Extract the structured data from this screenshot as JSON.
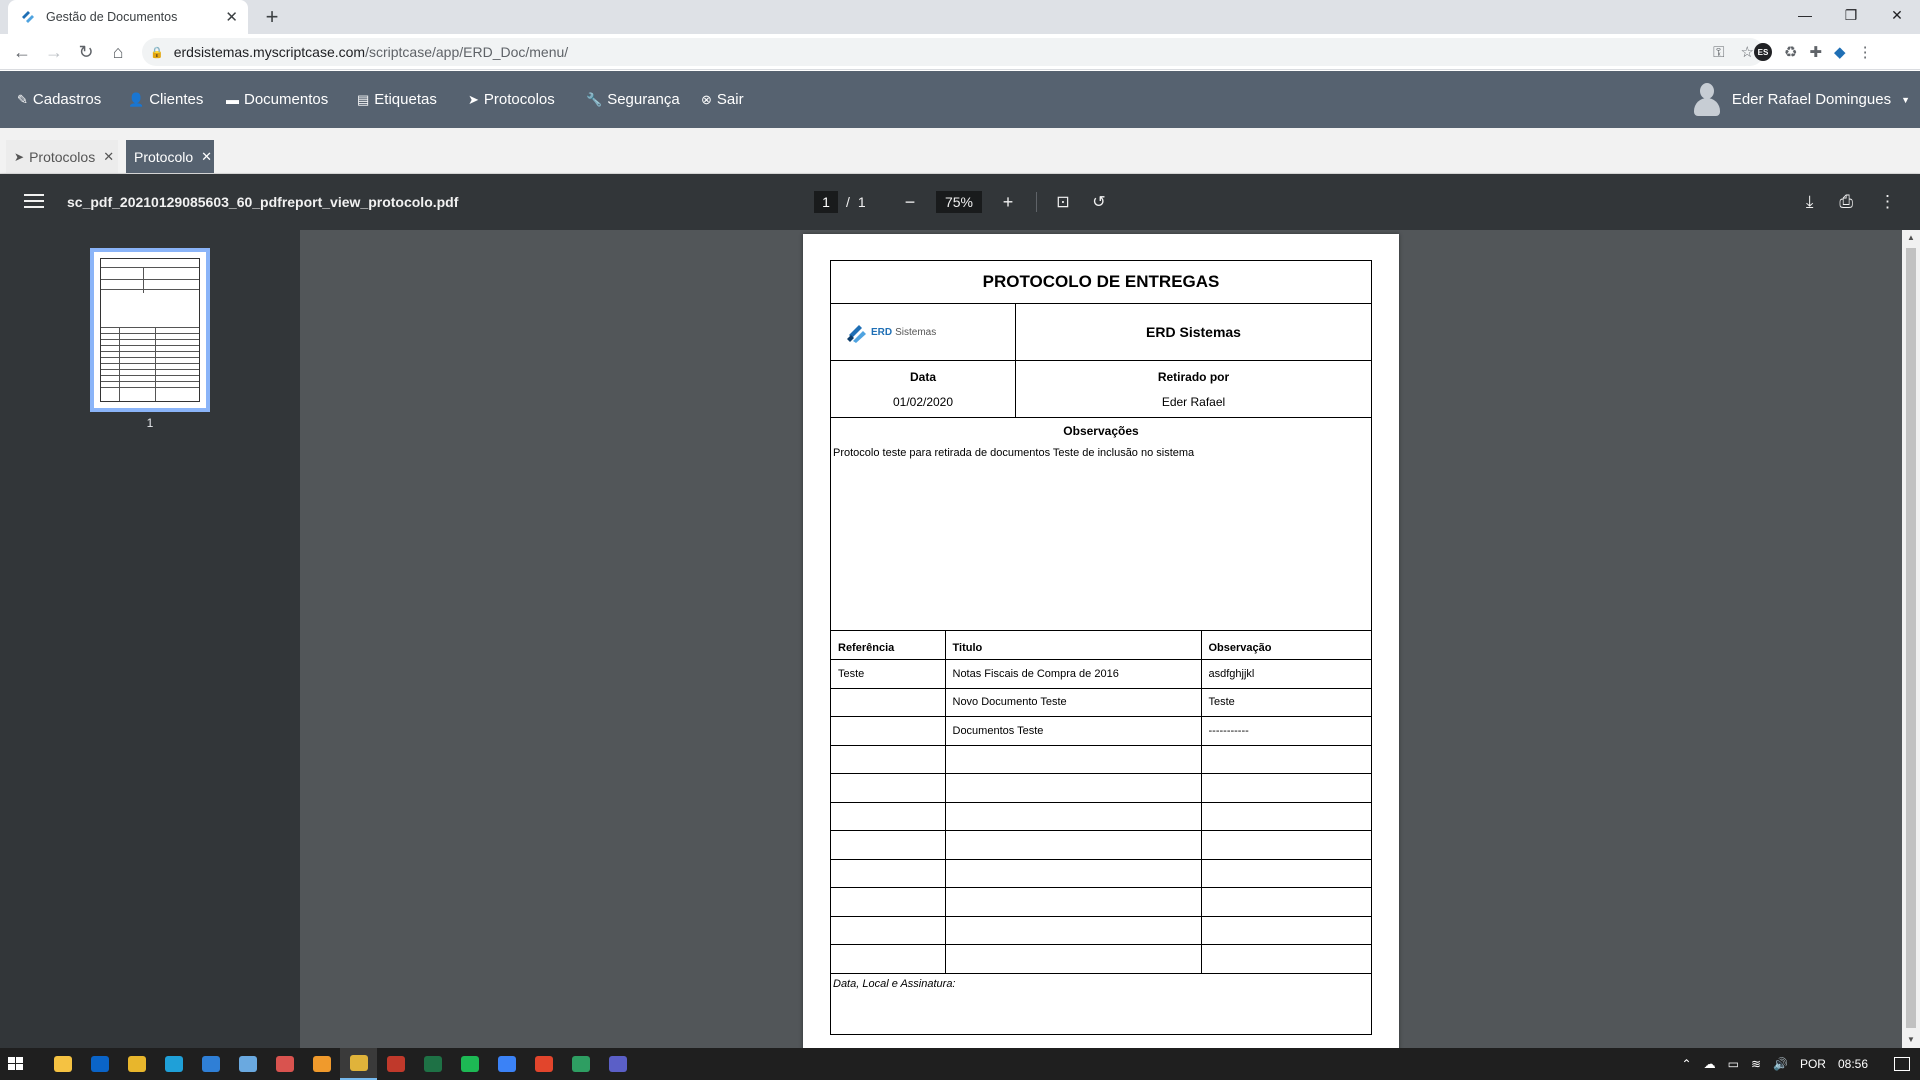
{
  "browser": {
    "tab_title": "Gestão de Documentos",
    "url_host": "erdsistemas.myscriptcase.com",
    "url_path": "/scriptcase/app/ERD_Doc/menu/",
    "ext_es": "ES"
  },
  "menu": {
    "items": [
      {
        "label": "Cadastros",
        "icon": "edit-icon"
      },
      {
        "label": "Clientes",
        "icon": "user-icon"
      },
      {
        "label": "Documentos",
        "icon": "document-icon"
      },
      {
        "label": "Etiquetas",
        "icon": "book-icon"
      },
      {
        "label": "Protocolos",
        "icon": "paper-plane-icon"
      },
      {
        "label": "Segurança",
        "icon": "wrench-icon"
      },
      {
        "label": "Sair",
        "icon": "close-circle-icon"
      }
    ],
    "user_name": "Eder Rafael Domingues"
  },
  "app_tabs": [
    {
      "label": "Protocolos",
      "active": false
    },
    {
      "label": "Protocolo",
      "active": true
    }
  ],
  "pdf_viewer": {
    "filename": "sc_pdf_20210129085603_60_pdfreport_view_protocolo.pdf",
    "current_page": "1",
    "page_sep": "/",
    "total_pages": "1",
    "zoom": "75%",
    "thumbnail_label": "1"
  },
  "document": {
    "title": "PROTOCOLO DE ENTREGAS",
    "logo_text_bold": "ERD",
    "logo_text": "Sistemas",
    "company": "ERD Sistemas",
    "date_label": "Data",
    "date_value": "01/02/2020",
    "withdrawn_label": "Retirado por",
    "withdrawn_value": "Eder Rafael",
    "obs_label": "Observações",
    "obs_text": "Protocolo teste para retirada de documentos  Teste de inclusão no sistema",
    "columns": [
      "Referência",
      "Titulo",
      "Observação"
    ],
    "rows": [
      [
        "Teste",
        "Notas Fiscais de Compra de 2016",
        "asdfghjjkl"
      ],
      [
        "",
        "Novo Documento Teste",
        "Teste"
      ],
      [
        "",
        "Documentos Teste",
        "-----------"
      ],
      [
        "",
        "",
        ""
      ],
      [
        "",
        "",
        ""
      ],
      [
        "",
        "",
        ""
      ],
      [
        "",
        "",
        ""
      ],
      [
        "",
        "",
        ""
      ],
      [
        "",
        "",
        ""
      ],
      [
        "",
        "",
        ""
      ],
      [
        "",
        "",
        ""
      ]
    ],
    "signature_label": "Data, Local e Assinatura:"
  },
  "taskbar": {
    "apps": [
      {
        "name": "file-explorer-icon",
        "color": "#f5c242"
      },
      {
        "name": "outlook-icon",
        "color": "#0a64c8"
      },
      {
        "name": "folder-app-icon",
        "color": "#e8b62c"
      },
      {
        "name": "edge-icon",
        "color": "#1fa0d8"
      },
      {
        "name": "mail-icon",
        "color": "#2f7fd6"
      },
      {
        "name": "notes-icon",
        "color": "#6aa9e0"
      },
      {
        "name": "app-red-icon",
        "color": "#d9534f"
      },
      {
        "name": "sublime-icon",
        "color": "#f09a2c"
      },
      {
        "name": "chrome-icon",
        "color": "#e0b33a",
        "active": true
      },
      {
        "name": "app-jet-icon",
        "color": "#c0392b"
      },
      {
        "name": "excel-icon",
        "color": "#1e7145"
      },
      {
        "name": "spotify-icon",
        "color": "#1db954"
      },
      {
        "name": "app-blue-icon",
        "color": "#3b82f6"
      },
      {
        "name": "brave-icon",
        "color": "#e2452c"
      },
      {
        "name": "app-window-icon",
        "color": "#2e9e62"
      },
      {
        "name": "teams-icon",
        "color": "#5b5fc7"
      }
    ],
    "language": "POR",
    "time": "08:56"
  }
}
